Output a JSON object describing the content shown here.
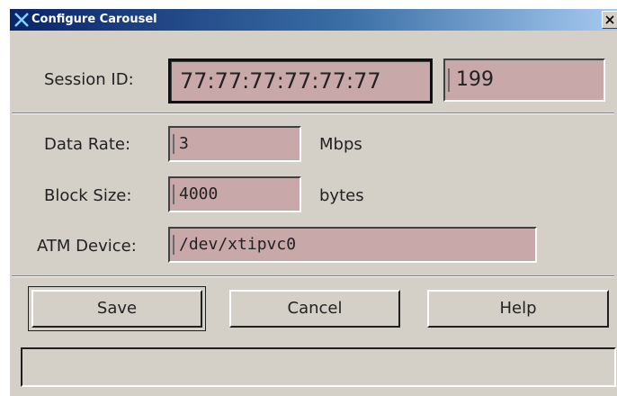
{
  "window": {
    "title": "Configure Carousel",
    "close_glyph": "×",
    "app_icon": "x-logo-icon",
    "close_icon": "close-icon"
  },
  "form": {
    "session_id": {
      "label": "Session ID:",
      "address": "77:77:77:77:77:77",
      "number": "199"
    },
    "data_rate": {
      "label": "Data Rate:",
      "value": "3",
      "unit": "Mbps"
    },
    "block_size": {
      "label": "Block Size:",
      "value": "4000",
      "unit": "bytes"
    },
    "atm_device": {
      "label": "ATM Device:",
      "value": "/dev/xtipvc0"
    }
  },
  "buttons": {
    "save": "Save",
    "cancel": "Cancel",
    "help": "Help"
  },
  "status": {
    "text": ""
  },
  "colors": {
    "field_bg": "#c8a8a8",
    "window_bg": "#d4d0c8",
    "titlebar_start": "#0a246a",
    "titlebar_end": "#a6caf0"
  }
}
